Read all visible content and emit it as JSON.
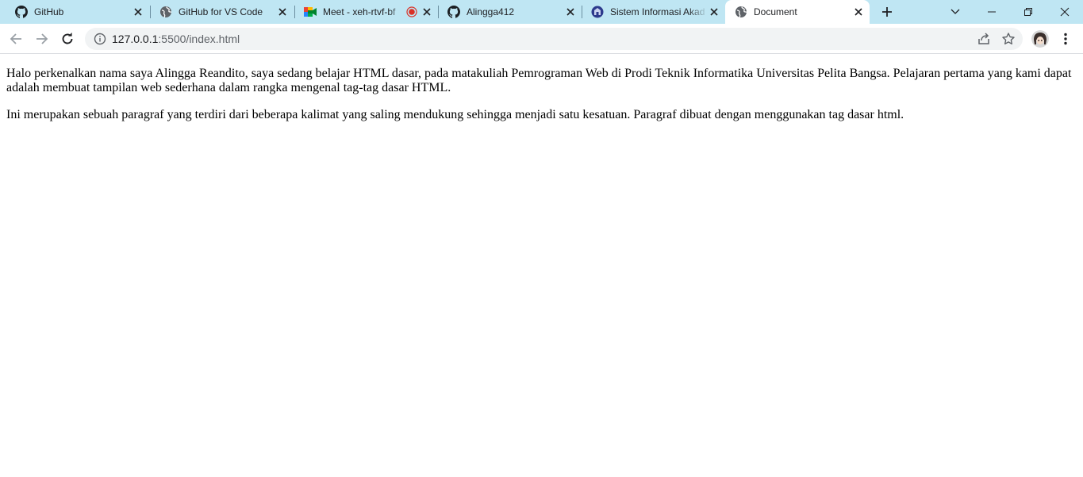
{
  "tabs": [
    {
      "title": "GitHub",
      "icon": "github-icon",
      "active": false
    },
    {
      "title": "GitHub for VS Code",
      "icon": "globe-icon",
      "active": false
    },
    {
      "title": "Meet - xeh-rtvf-bf",
      "icon": "google-meet-icon",
      "recording": true,
      "active": false
    },
    {
      "title": "Alingga412",
      "icon": "github-icon",
      "active": false
    },
    {
      "title": "Sistem Informasi Akad",
      "icon": "university-logo-icon",
      "active": false
    },
    {
      "title": "Document",
      "icon": "globe-icon",
      "active": true
    }
  ],
  "address_bar": {
    "host": "127.0.0.1",
    "path": ":5500/index.html"
  },
  "page": {
    "paragraphs": [
      "Halo perkenalkan nama saya Alingga Reandito, saya sedang belajar HTML dasar, pada matakuliah Pemrograman Web di Prodi Teknik Informatika Universitas Pelita Bangsa. Pelajaran pertama yang kami dapat adalah membuat tampilan web sederhana dalam rangka mengenal tag-tag dasar HTML.",
      "Ini merupakan sebuah paragraf yang terdiri dari beberapa kalimat yang saling mendukung sehingga menjadi satu kesatuan. Paragraf dibuat dengan menggunakan tag dasar html."
    ]
  },
  "colors": {
    "tabstrip": "#bfe6f3",
    "active_tab": "#ffffff",
    "omnibox": "#f1f3f4",
    "recording": "#d93025"
  }
}
